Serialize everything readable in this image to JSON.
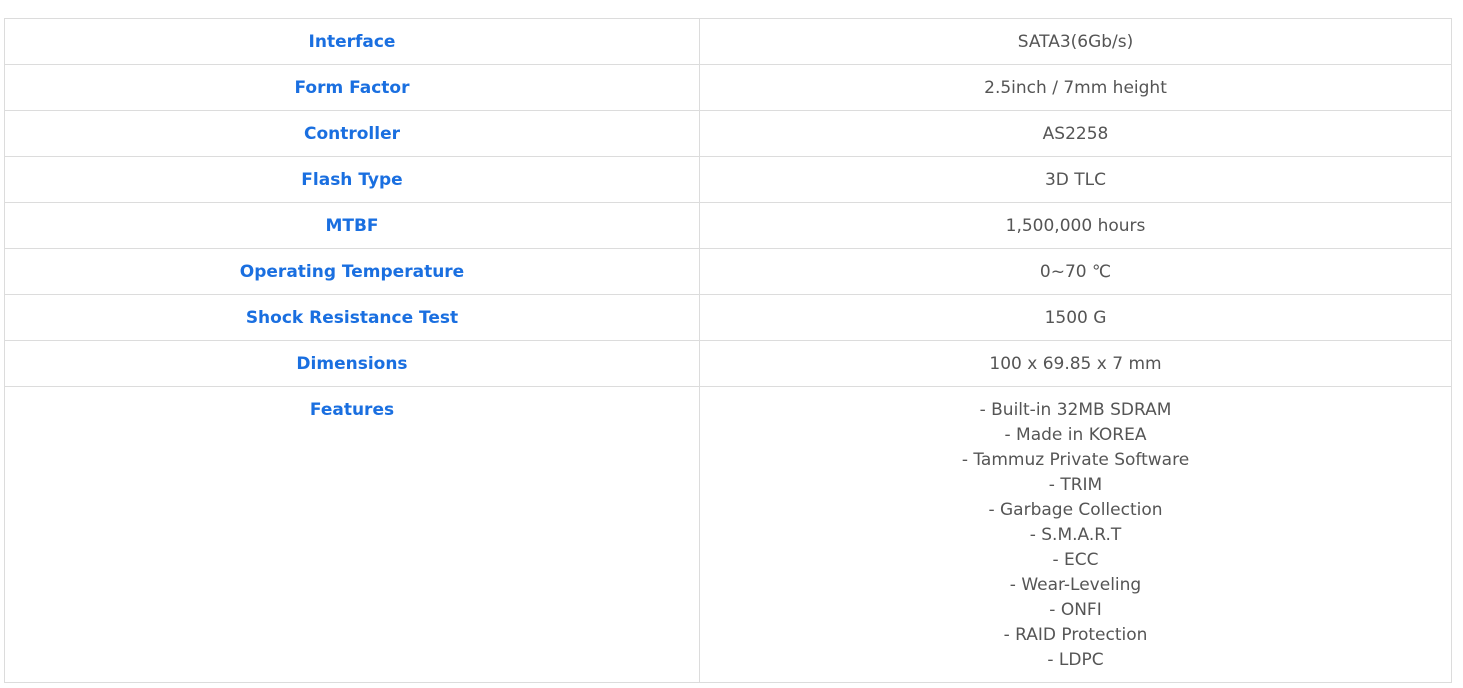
{
  "spec_table": {
    "rows": [
      {
        "label": "Interface",
        "value": "SATA3(6Gb/s)"
      },
      {
        "label": "Form Factor",
        "value": "2.5inch / 7mm height"
      },
      {
        "label": "Controller",
        "value": "AS2258"
      },
      {
        "label": "Flash Type",
        "value": "3D TLC"
      },
      {
        "label": "MTBF",
        "value": "1,500,000 hours"
      },
      {
        "label": "Operating Temperature",
        "value": "0~70 ℃"
      },
      {
        "label": "Shock Resistance Test",
        "value": "1500 G"
      },
      {
        "label": "Dimensions",
        "value": "100 x 69.85 x 7 mm"
      }
    ],
    "features": {
      "label": "Features",
      "items": [
        "- Built-in 32MB SDRAM",
        "- Made in KOREA",
        "- Tammuz Private Software",
        "- TRIM",
        "- Garbage Collection",
        "- S.M.A.R.T",
        "- ECC",
        "- Wear-Leveling",
        "- ONFI",
        "- RAID Protection",
        "- LDPC"
      ]
    }
  },
  "colors": {
    "label_text": "#1a6fe0",
    "value_text": "#555555",
    "border": "#dcdcdc",
    "background": "#ffffff"
  }
}
